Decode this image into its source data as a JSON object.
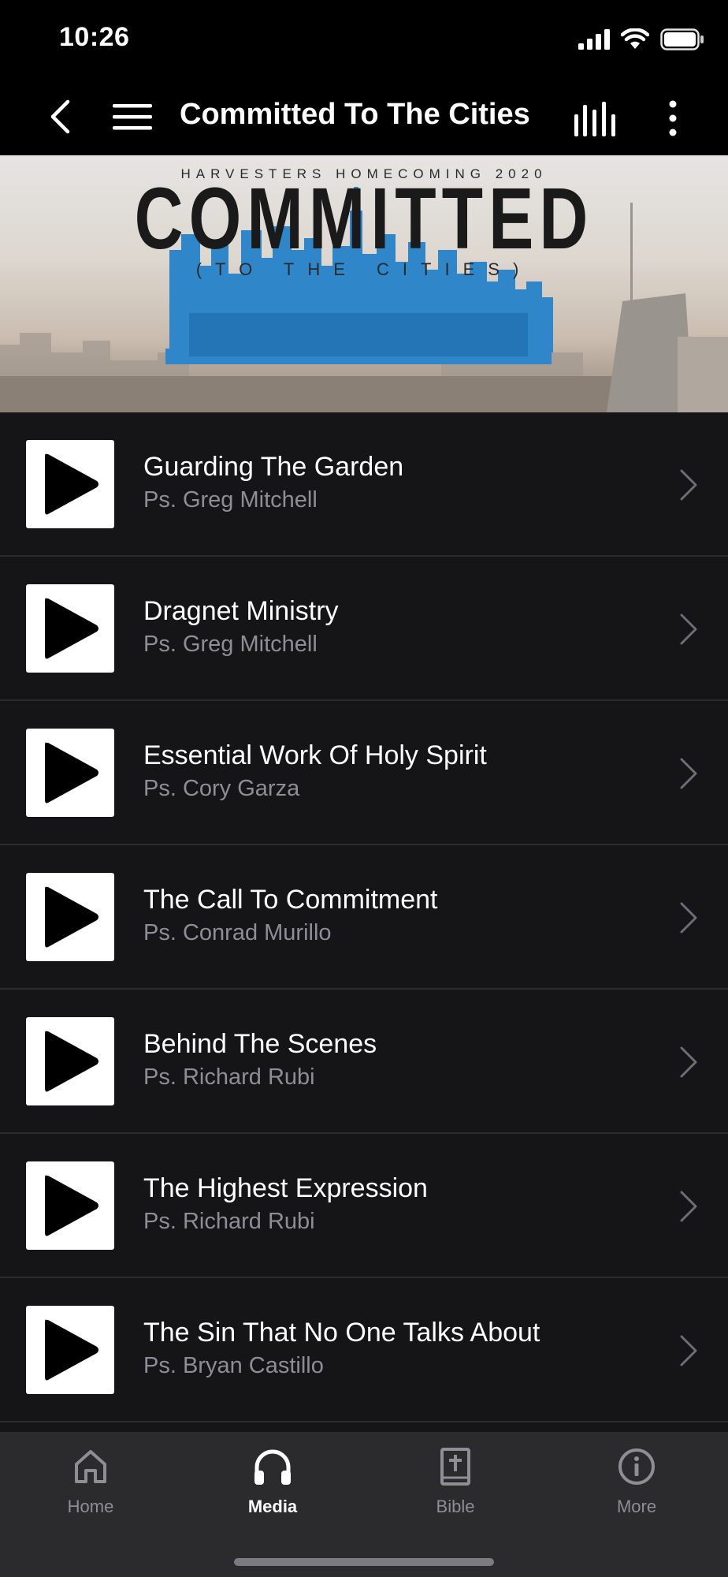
{
  "status_bar": {
    "time": "10:26",
    "icons": [
      "cellular-signal-icon",
      "wifi-icon",
      "battery-icon"
    ]
  },
  "nav": {
    "title": "Committed To The Cities",
    "icons": [
      "back-chevron-icon",
      "hamburger-menu-icon",
      "equalizer-bars-icon",
      "vertical-ellipsis-icon"
    ]
  },
  "banner": {
    "top_line": "HARVESTERS HOMECOMING 2020",
    "main": "COMMITTED",
    "sub": "(TO THE CITIES)"
  },
  "items": [
    {
      "title": "Guarding The Garden",
      "speaker": "Ps. Greg Mitchell"
    },
    {
      "title": "Dragnet Ministry",
      "speaker": "Ps. Greg Mitchell"
    },
    {
      "title": "Essential Work Of Holy Spirit",
      "speaker": "Ps. Cory Garza"
    },
    {
      "title": "The Call To Commitment",
      "speaker": "Ps. Conrad Murillo"
    },
    {
      "title": "Behind The Scenes",
      "speaker": "Ps. Richard Rubi"
    },
    {
      "title": "The Highest Expression",
      "speaker": "Ps. Richard Rubi"
    },
    {
      "title": "The Sin That No One Talks About",
      "speaker": "Ps. Bryan Castillo"
    }
  ],
  "tabs": [
    {
      "label": "Home",
      "icon": "home-icon",
      "active": false
    },
    {
      "label": "Media",
      "icon": "headphones-icon",
      "active": true
    },
    {
      "label": "Bible",
      "icon": "bible-icon",
      "active": false
    },
    {
      "label": "More",
      "icon": "info-icon",
      "active": false
    }
  ],
  "colors": {
    "background": "#000000",
    "list_background": "#151517",
    "tab_bar": "#2b2b2d",
    "skyline_accent": "#2f86c8",
    "secondary_text": "#8e8e93"
  }
}
